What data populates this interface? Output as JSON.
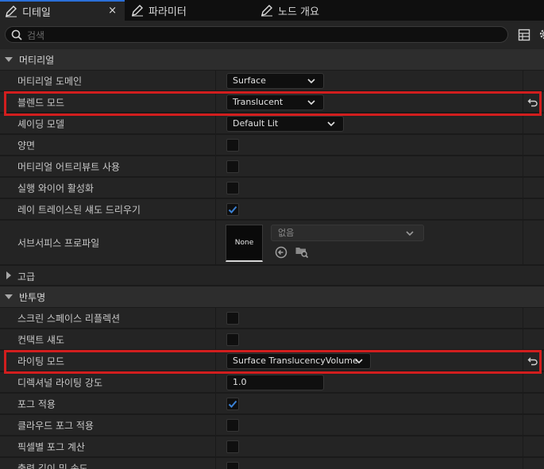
{
  "tabs": [
    {
      "label": "디테일",
      "active": true,
      "close": "×"
    },
    {
      "label": "파라미터",
      "active": false
    },
    {
      "label": "노드 개요",
      "active": false
    }
  ],
  "search": {
    "placeholder": "검색"
  },
  "sections": {
    "material": "머티리얼",
    "advanced": "고급",
    "translucency": "반투명"
  },
  "rows": {
    "material_domain": {
      "label": "머티리얼 도메인",
      "value": "Surface"
    },
    "blend_mode": {
      "label": "블렌드 모드",
      "value": "Translucent"
    },
    "shading_model": {
      "label": "셰이딩 모델",
      "value": "Default Lit"
    },
    "two_sided": {
      "label": "양면",
      "checked": false
    },
    "use_material_attributes": {
      "label": "머티리얼 어트리뷰트 사용",
      "checked": false
    },
    "cast_ray_traced_shadows_wire": {
      "label": "실행 와이어 활성화",
      "checked": false
    },
    "cast_ray_traced_shadows": {
      "label": "레이 트레이스된 섀도 드리우기",
      "checked": true
    },
    "subsurface_profile": {
      "label": "서브서피스 프로파일",
      "thumb": "None",
      "value": "없음"
    },
    "screen_space_reflections": {
      "label": "스크린 스페이스 리플렉션",
      "checked": false
    },
    "contact_shadows": {
      "label": "컨택트 섀도",
      "checked": false
    },
    "lighting_mode": {
      "label": "라이팅 모드",
      "value": "Surface TranslucencyVolume"
    },
    "directional_lighting_intensity": {
      "label": "디렉셔널 라이팅 강도",
      "value": "1.0"
    },
    "apply_fogging": {
      "label": "포그 적용",
      "checked": true
    },
    "apply_cloud_fogging": {
      "label": "클라우드 포그 적용",
      "checked": false
    },
    "compute_fog_per_pixel": {
      "label": "픽셀별 포그 계산",
      "checked": false
    },
    "output_depth_velocity": {
      "label": "출력 깊이 및 속도",
      "checked": false
    }
  },
  "colors": {
    "accent": "#2a6fd8",
    "highlight": "#d21e1e",
    "check": "#3b82d6"
  }
}
